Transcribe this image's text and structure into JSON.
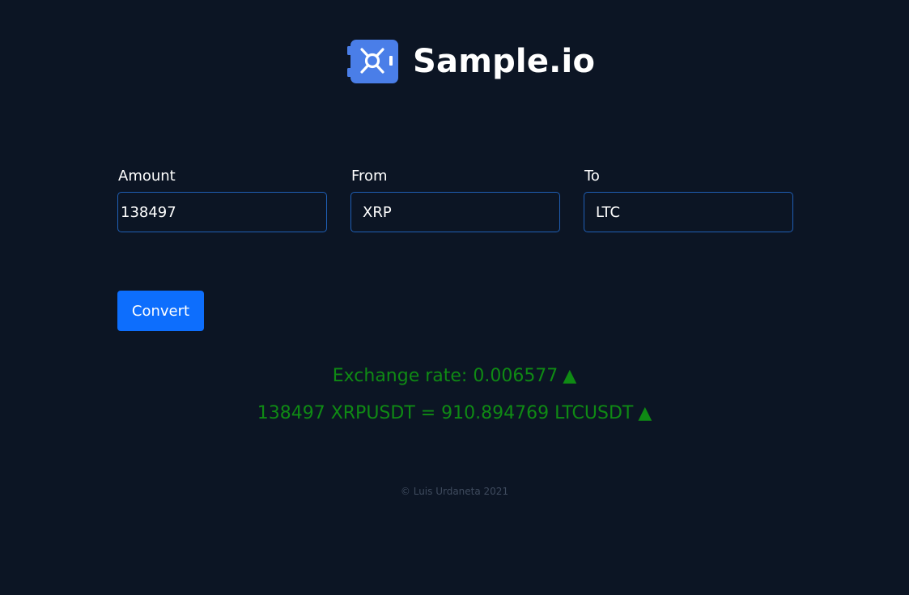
{
  "brand": {
    "name": "Sample.io",
    "logo_icon": "vault-icon",
    "logo_color": "#4a7ee8"
  },
  "form": {
    "amount": {
      "label": "Amount",
      "value": "138497"
    },
    "from": {
      "label": "From",
      "value": "XRP"
    },
    "to": {
      "label": "To",
      "value": "LTC"
    },
    "border_color": "#1f5fb5"
  },
  "convert_button": {
    "label": "Convert",
    "color": "#0d6efd"
  },
  "result": {
    "rate_text": "Exchange rate: 0.006577",
    "conversion_text": "138497 XRPUSDT = 910.894769 LTCUSDT",
    "trend_icon": "triangle-up-icon",
    "trend_glyph": "▲",
    "color": "#0f8a14"
  },
  "footer": {
    "copyright": "© Luis Urdaneta 2021"
  },
  "theme": {
    "background": "#0c1524"
  }
}
